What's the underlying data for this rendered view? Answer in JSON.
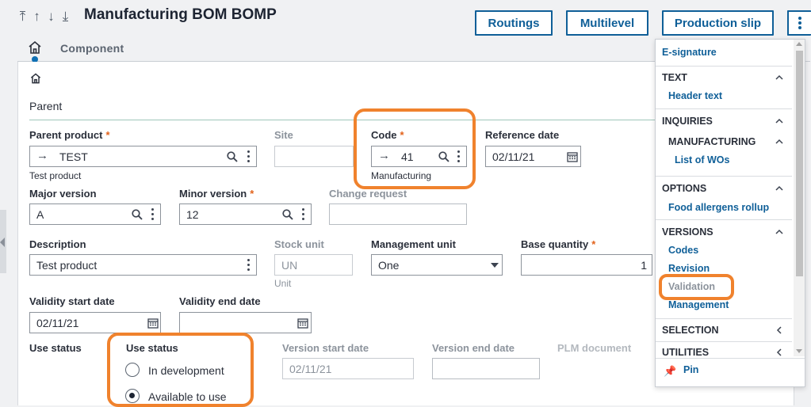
{
  "header": {
    "title": "Manufacturing BOM BOMP",
    "nav_icons": [
      "arrow-first-icon",
      "arrow-up-icon",
      "arrow-down-icon",
      "arrow-last-icon"
    ],
    "buttons": {
      "routings": "Routings",
      "multilevel": "Multilevel",
      "production_slip": "Production slip"
    }
  },
  "tabs": {
    "component": "Component"
  },
  "section": {
    "title": "Parent"
  },
  "form": {
    "parent_product": {
      "label": "Parent product",
      "value": "TEST",
      "sub": "Test product"
    },
    "site": {
      "label": "Site",
      "value": ""
    },
    "code": {
      "label": "Code",
      "value": "41",
      "sub": "Manufacturing"
    },
    "reference_date": {
      "label": "Reference date",
      "value": "02/11/21"
    },
    "major_version": {
      "label": "Major version",
      "value": "A"
    },
    "minor_version": {
      "label": "Minor version",
      "value": "12"
    },
    "change_request": {
      "label": "Change request",
      "value": ""
    },
    "description": {
      "label": "Description",
      "value": "Test product"
    },
    "stock_unit": {
      "label": "Stock unit",
      "value": "UN",
      "sub": "Unit"
    },
    "management_unit": {
      "label": "Management unit",
      "value": "One"
    },
    "base_quantity": {
      "label": "Base quantity",
      "value": "1"
    },
    "validity_start_date": {
      "label": "Validity start date",
      "value": "02/11/21"
    },
    "validity_end_date": {
      "label": "Validity end date",
      "value": ""
    },
    "use_status_left": {
      "label": "Use status"
    },
    "use_status": {
      "label": "Use status",
      "options": [
        "In development",
        "Available to use"
      ],
      "selected": "Available to use"
    },
    "version_start_date": {
      "label": "Version start date",
      "value": "02/11/21"
    },
    "version_end_date": {
      "label": "Version end date",
      "value": ""
    },
    "plm_document": {
      "label": "PLM document"
    },
    "required_mark": "*"
  },
  "menu": {
    "e_signature": "E-signature",
    "text": {
      "title": "TEXT",
      "items": [
        "Header text"
      ]
    },
    "inquiries": {
      "title": "INQUIRIES",
      "sub_title": "MANUFACTURING",
      "items": [
        "List of WOs"
      ]
    },
    "options": {
      "title": "OPTIONS",
      "items": [
        "Food allergens rollup"
      ]
    },
    "versions": {
      "title": "VERSIONS",
      "items": [
        "Codes",
        "Revision",
        "Validation",
        "Management"
      ]
    },
    "selection": {
      "title": "SELECTION"
    },
    "utilities": {
      "title": "UTILITIES"
    },
    "pin": "Pin"
  },
  "colors": {
    "accent": "#0f5f98",
    "highlight": "#f0822d",
    "required": "#e2621b"
  }
}
